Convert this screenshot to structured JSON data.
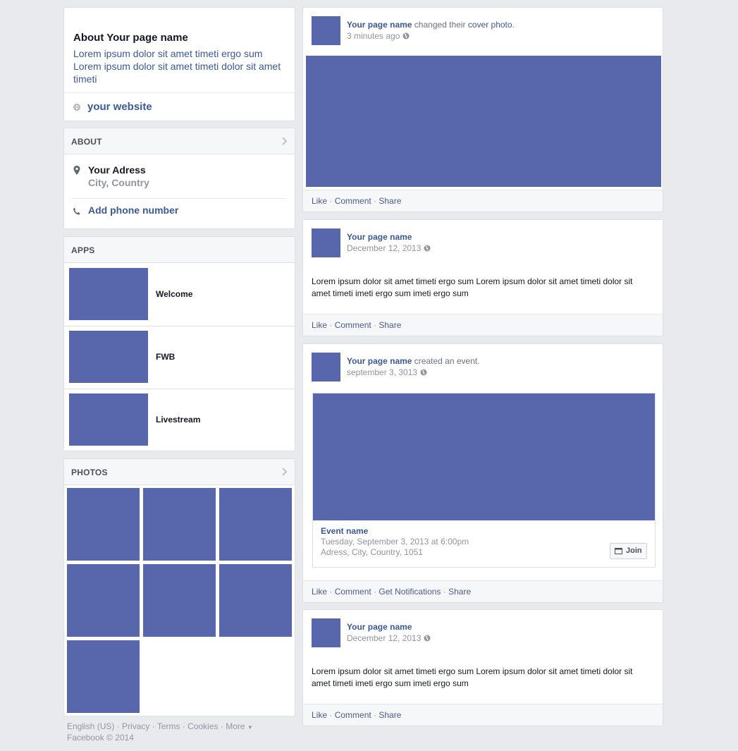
{
  "colors": {
    "accent": "#3b5998",
    "placeholder_block": "#5866ab",
    "background": "#e9eaed"
  },
  "about_box": {
    "title": "About Your page name",
    "description": "Lorem ipsum dolor sit amet timeti ergo sum Lorem ipsum dolor sit amet timeti dolor sit amet timeti",
    "website": "your website",
    "website_icon": "globe-icon"
  },
  "about_section": {
    "header": "ABOUT",
    "address_line1": "Your Adress",
    "address_line2": "City, Country",
    "phone": "Add phone number"
  },
  "apps_section": {
    "header": "APPS",
    "items": [
      {
        "label": "Welcome"
      },
      {
        "label": "FWB"
      },
      {
        "label": "Livestream"
      }
    ]
  },
  "photos_section": {
    "header": "PHOTOS"
  },
  "footer": {
    "links": [
      "English (US)",
      "Privacy",
      "Terms",
      "Cookies",
      "More"
    ],
    "copyright": "Facebook © 2014"
  },
  "posts": [
    {
      "author": "Your page name",
      "action_prefix": " changed their ",
      "action_link": "cover photo",
      "action_suffix": ".",
      "time": "3 minutes ago",
      "actions": [
        "Like",
        "Comment",
        "Share"
      ]
    },
    {
      "author": "Your page name",
      "time": "December 12, 2013",
      "text": "Lorem ipsum dolor sit amet timeti ergo sum Lorem ipsum dolor sit amet timeti dolor sit amet timeti imeti ergo sum imeti ergo sum",
      "actions": [
        "Like",
        "Comment",
        "Share"
      ]
    },
    {
      "author": "Your page name",
      "action_prefix": " created an event.",
      "time": "september 3, 3013",
      "event": {
        "name": "Event name",
        "date": "Tuesday, September 3, 2013 at 6:00pm",
        "address": "Adress, City, Country, 1051",
        "join_label": "Join"
      },
      "actions": [
        "Like",
        "Comment",
        "Get Notifications",
        "Share"
      ]
    },
    {
      "author": "Your page name",
      "time": "December 12, 2013",
      "text": "Lorem ipsum dolor sit amet timeti ergo sum Lorem ipsum dolor sit amet timeti dolor sit amet timeti imeti ergo sum imeti ergo sum",
      "actions": [
        "Like",
        "Comment",
        "Share"
      ]
    }
  ]
}
